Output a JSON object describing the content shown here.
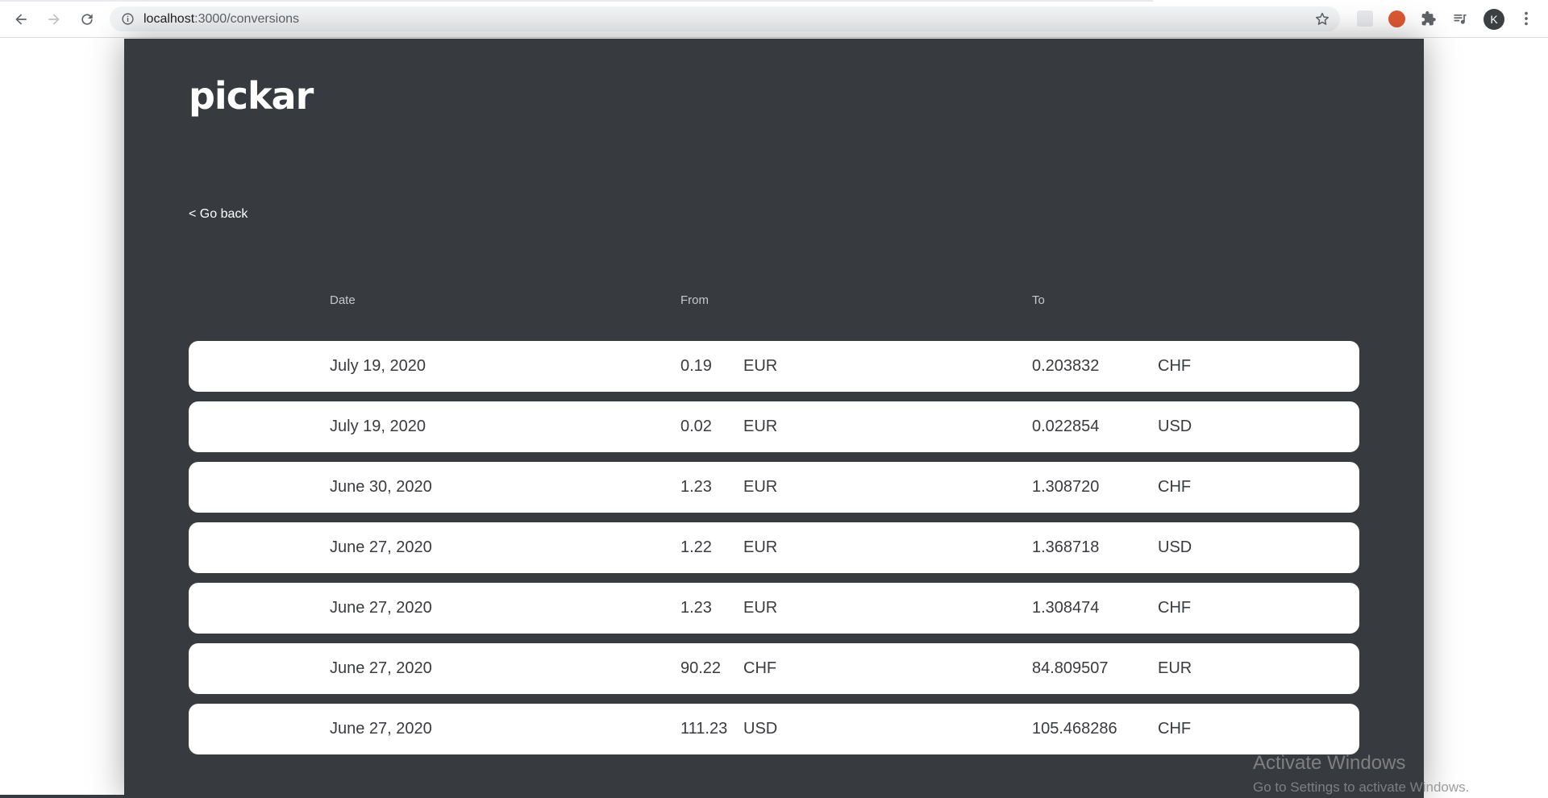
{
  "browser": {
    "url_host": "localhost",
    "url_path": ":3000/conversions",
    "avatar_initial": "K"
  },
  "app": {
    "logo": "pickar",
    "go_back": "< Go back",
    "headers": {
      "date": "Date",
      "from": "From",
      "to": "To"
    },
    "rows": [
      {
        "date": "July 19, 2020",
        "from_amount": "0.19",
        "from_currency": "EUR",
        "to_amount": "0.203832",
        "to_currency": "CHF"
      },
      {
        "date": "July 19, 2020",
        "from_amount": "0.02",
        "from_currency": "EUR",
        "to_amount": "0.022854",
        "to_currency": "USD"
      },
      {
        "date": "June 30, 2020",
        "from_amount": "1.23",
        "from_currency": "EUR",
        "to_amount": "1.308720",
        "to_currency": "CHF"
      },
      {
        "date": "June 27, 2020",
        "from_amount": "1.22",
        "from_currency": "EUR",
        "to_amount": "1.368718",
        "to_currency": "USD"
      },
      {
        "date": "June 27, 2020",
        "from_amount": "1.23",
        "from_currency": "EUR",
        "to_amount": "1.308474",
        "to_currency": "CHF"
      },
      {
        "date": "June 27, 2020",
        "from_amount": "90.22",
        "from_currency": "CHF",
        "to_amount": "84.809507",
        "to_currency": "EUR"
      },
      {
        "date": "June 27, 2020",
        "from_amount": "111.23",
        "from_currency": "USD",
        "to_amount": "105.468286",
        "to_currency": "CHF"
      }
    ]
  },
  "watermark": {
    "title": "Activate Windows",
    "subtitle": "Go to Settings to activate Windows."
  },
  "colors": {
    "app_background": "#373a3f",
    "row_background": "#ffffff",
    "text_dark": "#3a3b3f"
  }
}
